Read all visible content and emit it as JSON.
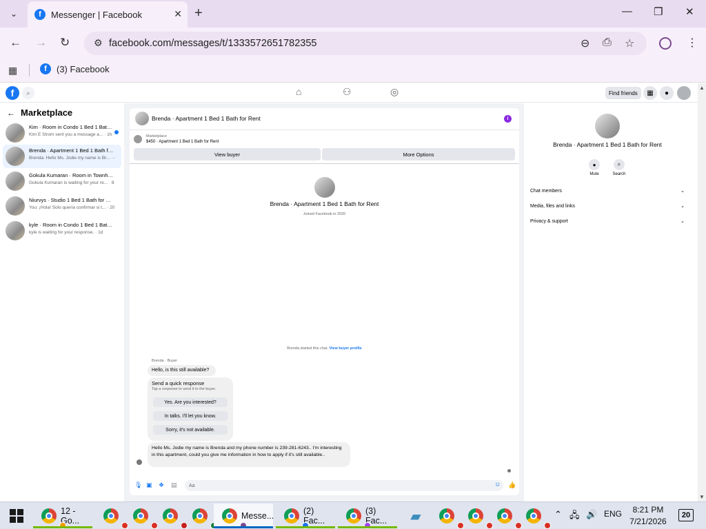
{
  "browser": {
    "tab_title": "Messenger | Facebook",
    "url": "facebook.com/messages/t/1333572651782355",
    "bookmark": "(3) Facebook"
  },
  "fb_header": {
    "find_friends": "Find friends"
  },
  "sidebar": {
    "title": "Marketplace",
    "conversations": [
      {
        "name": "Kim · Room in Condo 1 Bed 1 Bath for Rent",
        "preview": "Kim E Strom sent you a message a... · 1h",
        "unread": true
      },
      {
        "name": "Brenda · Apartment 1 Bed 1 Bath for Rent",
        "preview": "Brenda: Hello Ms. Jodie my name is Br... · 4h",
        "active": true
      },
      {
        "name": "Gokula Kumaran · Room in Townhouse",
        "preview": "Gokula Kumaran is waiting for your re... · 8h"
      },
      {
        "name": "Niurvys · Studio 1 Bed 1 Bath for Rent",
        "preview": "You: ¡Hola! Solo quería confirmar si t... · 20h"
      },
      {
        "name": "kyle · Room in Condo 1 Bed 1 Bath for Rent",
        "preview": "kyle is waiting for your response. · 1d"
      }
    ]
  },
  "chat": {
    "title": "Brenda · Apartment 1 Bed 1 Bath for Rent",
    "listing_source": "Marketplace",
    "listing_price_title": "$450 · Apartment 1 Bed 1 Bath for Rent",
    "view_buyer": "View buyer",
    "more_options": "More Options",
    "profile_name": "Brenda · Apartment 1 Bed 1 Bath for Rent",
    "profile_sub": "Joined Facebook in 2020",
    "started_text": "Brenda started this chat.",
    "started_link": "View buyer profile",
    "sender_label": "Brenda · Buyer",
    "msg1": "Hello, is this still available?",
    "quick_title": "Send a quick response",
    "quick_sub": "Tap a response to send it to the buyer.",
    "quick_responses": [
      "Yes. Are you interested?",
      "In talks. I'll let you know.",
      "Sorry, it's not available."
    ],
    "msg2": "Hello Ms. Jodie my name is Brenda and my phone number is 239-281-6243.. I'm interesting in this apartment, could you give me information in how to apply if it's still available..",
    "composer_placeholder": "Aa"
  },
  "details": {
    "name": "Brenda · Apartment 1 Bed 1 Bath for Rent",
    "mute": "Mute",
    "search": "Search",
    "sections": [
      "Chat members",
      "Media, files and links",
      "Privacy & support"
    ]
  },
  "taskbar": {
    "chrome_item": "12 - Go...",
    "messenger_item": "Messe...",
    "fb2_item": "(2) Fac...",
    "fb3_item": "(3) Fac...",
    "lang": "ENG",
    "time": "8:21 PM",
    "date": "7/21/2026",
    "notifications": "20"
  }
}
